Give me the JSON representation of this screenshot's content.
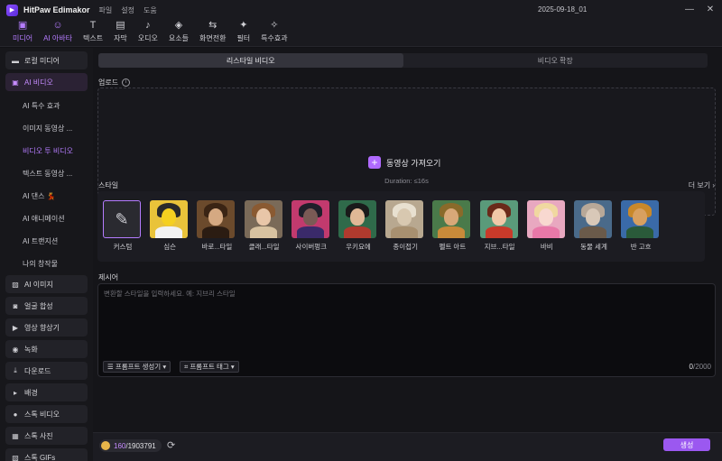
{
  "titlebar": {
    "app_name": "HitPaw Edimakor",
    "menu": [
      "파일",
      "설정",
      "도움"
    ],
    "project": "2025-09-18_01",
    "controls": [
      "minimize-icon",
      "close-icon"
    ]
  },
  "toolbar": {
    "items": [
      {
        "label": "미디어",
        "icon": "media-icon"
      },
      {
        "label": "AI 아바타",
        "icon": "avatar-icon"
      },
      {
        "label": "텍스트",
        "icon": "text-icon"
      },
      {
        "label": "자막",
        "icon": "subtitle-icon"
      },
      {
        "label": "오디오",
        "icon": "audio-icon"
      },
      {
        "label": "요소들",
        "icon": "elements-icon"
      },
      {
        "label": "화면전환",
        "icon": "transition-icon"
      },
      {
        "label": "필터",
        "icon": "filter-icon"
      },
      {
        "label": "특수효과",
        "icon": "effects-icon"
      }
    ],
    "active_index": 0
  },
  "sidebar": {
    "items": [
      {
        "label": "로컬 미디어",
        "type": "item",
        "icon": "folder-icon"
      },
      {
        "label": "AI 비디오",
        "type": "item",
        "icon": "ai-video-icon",
        "active": true
      },
      {
        "label": "AI 특수 효과",
        "type": "sub"
      },
      {
        "label": "이미지 동영상 ...",
        "type": "sub"
      },
      {
        "label": "비디오 투 비디오",
        "type": "sub",
        "active": true
      },
      {
        "label": "텍스트 동영상 ...",
        "type": "sub"
      },
      {
        "label": "AI 댄스 💃",
        "type": "sub"
      },
      {
        "label": "AI 애니메이션",
        "type": "sub"
      },
      {
        "label": "AI 트랜지션",
        "type": "sub"
      },
      {
        "label": "나의 창작물",
        "type": "sub"
      },
      {
        "label": "AI 이미지",
        "type": "item",
        "icon": "image-icon"
      },
      {
        "label": "얼굴 합성",
        "type": "item",
        "icon": "face-icon"
      },
      {
        "label": "영상 향상기",
        "type": "item",
        "icon": "enhance-icon"
      },
      {
        "label": "녹화",
        "type": "item",
        "icon": "record-icon"
      },
      {
        "label": "다운로드",
        "type": "item",
        "icon": "download-icon"
      },
      {
        "label": "배경",
        "type": "item",
        "icon": "caret-right-icon"
      },
      {
        "label": "스톡 비디오",
        "type": "item",
        "icon": "stock-video-icon"
      },
      {
        "label": "스톡 사진",
        "type": "item",
        "icon": "stock-photo-icon"
      },
      {
        "label": "스톡 GIFs",
        "type": "item",
        "icon": "stock-gif-icon"
      }
    ]
  },
  "main": {
    "tabs": [
      {
        "label": "리스타일 비디오",
        "active": true
      },
      {
        "label": "비디오 확장",
        "active": false
      }
    ],
    "upload": {
      "section_label": "업로드",
      "button_label": "동영상 가져오기",
      "duration": "Duration: ≤16s"
    },
    "styles": {
      "section_label": "스타일",
      "more_label": "더 보기",
      "items": [
        {
          "name": "커스텀",
          "kind": "custom"
        },
        {
          "name": "심슨",
          "bg": "#e9c33a",
          "hair": "#2a2a2a",
          "face": "#f5d020",
          "body": "#f2f2f2"
        },
        {
          "name": "바로...타일",
          "bg": "#6b4a2c",
          "hair": "#3a2414",
          "face": "#d5a982",
          "body": "#2b1c12"
        },
        {
          "name": "클래...타일",
          "bg": "#7a6a58",
          "hair": "#8a5a32",
          "face": "#e8c6a8",
          "body": "#d8c2a0"
        },
        {
          "name": "사이버펑크",
          "bg": "#c23a6e",
          "hair": "#1f1f2a",
          "face": "#7a5a55",
          "body": "#3a2a6a"
        },
        {
          "name": "우키요에",
          "bg": "#2f6a4a",
          "hair": "#1a1a1a",
          "face": "#e0b896",
          "body": "#b03a2e"
        },
        {
          "name": "종이접기",
          "bg": "#b8a890",
          "hair": "#e8e0d0",
          "face": "#d8c8b0",
          "body": "#a89070"
        },
        {
          "name": "펠트 아트",
          "bg": "#4a7a4a",
          "hair": "#8a6a2a",
          "face": "#d8a878",
          "body": "#c88a3a"
        },
        {
          "name": "지브...타일",
          "bg": "#5a9a7a",
          "hair": "#6a2a1a",
          "face": "#f0c8a8",
          "body": "#c83a2a"
        },
        {
          "name": "바비",
          "bg": "#e8a8c0",
          "hair": "#f0d8a0",
          "face": "#f8d8d0",
          "body": "#e878a8"
        },
        {
          "name": "동물 세계",
          "bg": "#4a6a8a",
          "hair": "#b8a898",
          "face": "#d8c8b8",
          "body": "#6a5a4a"
        },
        {
          "name": "반 고흐",
          "bg": "#3a6aa8",
          "hair": "#c8882a",
          "face": "#d8a060",
          "body": "#2a5a3a"
        }
      ]
    },
    "prompt": {
      "section_label": "제시어",
      "placeholder": "변환할 스타일을 입력하세요. 예: 지브리 스타일",
      "generate_prompt_label": "프롬프트 생성기",
      "prompt_tag_label": "프롬프트 태그",
      "count_current": "0",
      "count_max": "/2000"
    }
  },
  "footer": {
    "credits_used": "160",
    "credits_total": "/1903791",
    "generate_label": "생성"
  }
}
